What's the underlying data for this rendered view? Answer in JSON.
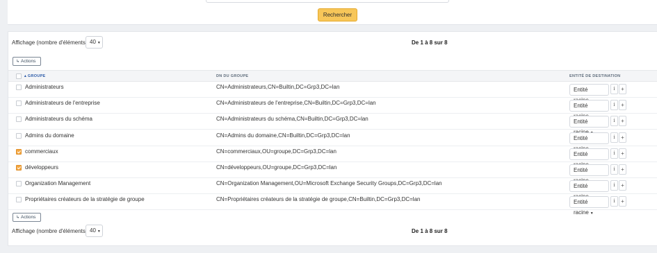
{
  "search": {
    "button_label": "Rechercher"
  },
  "paging_top": {
    "label": "Affichage (nombre d'éléments)",
    "page_size": "40",
    "info": "De 1 à 8 sur 8"
  },
  "paging_bottom": {
    "label": "Affichage (nombre d'éléments)",
    "page_size": "40",
    "info": "De 1 à 8 sur 8"
  },
  "actions_label": "Actions",
  "columns": {
    "group": "GROUPE",
    "dn": "DN DU GROUPE",
    "entity": "ENTITÉ DE DESTINATION"
  },
  "rows": [
    {
      "checked": false,
      "group": "Administrateurs",
      "dn": "CN=Administrateurs,CN=Builtin,DC=Grp3,DC=lan",
      "entity": "Entité racine"
    },
    {
      "checked": false,
      "group": "Administrateurs de l'entreprise",
      "dn": "CN=Administrateurs de l'entreprise,CN=Builtin,DC=Grp3,DC=lan",
      "entity": "Entité racine"
    },
    {
      "checked": false,
      "group": "Administrateurs du schéma",
      "dn": "CN=Administrateurs du schéma,CN=Builtin,DC=Grp3,DC=lan",
      "entity": "Entité racine"
    },
    {
      "checked": false,
      "group": "Admins du domaine",
      "dn": "CN=Admins du domaine,CN=Builtin,DC=Grp3,DC=lan",
      "entity": "Entité racine"
    },
    {
      "checked": true,
      "group": "commerciaux",
      "dn": "CN=commerciaux,OU=groupe,DC=Grp3,DC=lan",
      "entity": "Entité racine"
    },
    {
      "checked": true,
      "group": "développeurs",
      "dn": "CN=développeurs,OU=groupe,DC=Grp3,DC=lan",
      "entity": "Entité racine"
    },
    {
      "checked": false,
      "group": "Organization Management",
      "dn": "CN=Organization Management,OU=Microsoft Exchange Security Groups,DC=Grp3,DC=lan",
      "entity": "Entité racine"
    },
    {
      "checked": false,
      "group": "Propriétaires créateurs de la stratégie de groupe",
      "dn": "CN=Propriétaires créateurs de la stratégie de groupe,CN=Builtin,DC=Grp3,DC=lan",
      "entity": "Entité racine"
    }
  ],
  "icons": {
    "chevron": "chevron-down-icon",
    "info": "info-icon",
    "plus": "plus-icon",
    "actions": "corner-arrow-icon",
    "sort": "sort-icon"
  },
  "colors": {
    "search_button": "#f7c659",
    "checkbox_checked": "#f4a742",
    "sort_header": "#2b5aa8"
  }
}
